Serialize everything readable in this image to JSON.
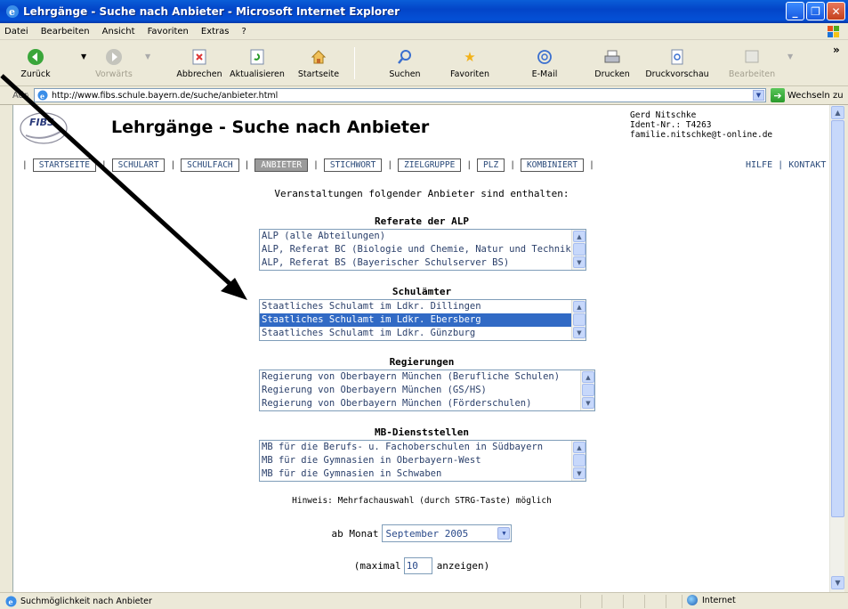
{
  "window": {
    "title": "Lehrgänge - Suche nach Anbieter - Microsoft Internet Explorer",
    "minimize": "_",
    "maximize": "❐",
    "close": "✕"
  },
  "menu": [
    "Datei",
    "Bearbeiten",
    "Ansicht",
    "Favoriten",
    "Extras",
    "?"
  ],
  "toolbar": {
    "back": "Zurück",
    "forward": "Vorwärts",
    "stop": "Abbrechen",
    "refresh": "Aktualisieren",
    "home": "Startseite",
    "search": "Suchen",
    "favorites": "Favoriten",
    "mail": "E-Mail",
    "print": "Drucken",
    "preview": "Druckvorschau",
    "edit": "Bearbeiten",
    "more": "»"
  },
  "address": {
    "label": "Adresse",
    "url": "http://www.fibs.schule.bayern.de/suche/anbieter.html",
    "go": "Wechseln zu"
  },
  "page": {
    "logo_text": "FIBS",
    "title": "Lehrgänge - Suche nach Anbieter",
    "user": {
      "name": "Gerd Nitschke",
      "ident": "Ident-Nr.: T4263",
      "email": "familie.nitschke@t-online.de"
    },
    "nav": [
      "STARTSEITE",
      "SCHULART",
      "SCHULFACH",
      "ANBIETER",
      "STICHWORT",
      "ZIELGRUPPE",
      "PLZ",
      "KOMBINIERT"
    ],
    "nav_active": "ANBIETER",
    "help": "HILFE",
    "contact": "KONTAKT",
    "help_sep": "|",
    "intro": "Veranstaltungen folgender Anbieter sind enthalten:",
    "sections": [
      {
        "heading": "Referate der ALP",
        "options": [
          "ALP (alle Abteilungen)",
          "ALP, Referat BC (Biologie und Chemie, Natur und Technik",
          "ALP, Referat BS (Bayerischer Schulserver BS)"
        ],
        "selected": -1
      },
      {
        "heading": "Schulämter",
        "options": [
          "Staatliches Schulamt im Ldkr. Dillingen",
          "Staatliches Schulamt im Ldkr. Ebersberg",
          "Staatliches Schulamt im Ldkr. Günzburg"
        ],
        "selected": 1
      },
      {
        "heading": "Regierungen",
        "options": [
          "Regierung von Oberbayern München (Berufliche Schulen)",
          "Regierung von Oberbayern München (GS/HS)",
          "Regierung von Oberbayern München (Förderschulen)"
        ],
        "selected": -1
      },
      {
        "heading": "MB-Dienststellen",
        "options": [
          "MB für die Berufs- u. Fachoberschulen in Südbayern",
          "MB für die Gymnasien in Oberbayern-West",
          "MB für die Gymnasien in Schwaben"
        ],
        "selected": -1
      }
    ],
    "hint": "Hinweis: Mehrfachauswahl (durch STRG-Taste) möglich",
    "month_label": "ab Monat",
    "month_value": "September 2005",
    "max_prefix": "(maximal",
    "max_value": "10",
    "max_suffix": "anzeigen)"
  },
  "status": {
    "text": "Suchmöglichkeit nach Anbieter",
    "zone": "Internet"
  },
  "colors": {
    "selection": "#316ac5",
    "link": "#2a4a7a",
    "titlebar": "#0450d6"
  }
}
